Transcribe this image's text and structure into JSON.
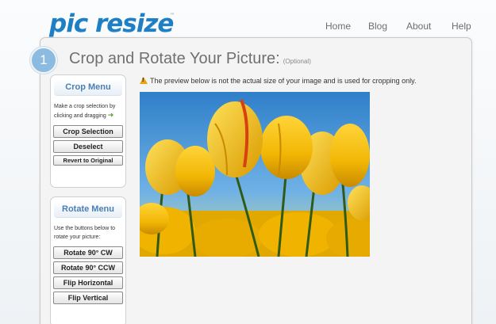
{
  "logo": {
    "text": "pic resize",
    "tm": "™"
  },
  "nav": [
    {
      "label": "Home"
    },
    {
      "label": "Blog"
    },
    {
      "label": "About"
    },
    {
      "label": "Help"
    }
  ],
  "step": {
    "number": "1",
    "title": "Crop and Rotate Your Picture:",
    "optional": "(Optional)"
  },
  "notice": "The preview below is not the actual size of your image and is used for cropping only.",
  "crop_menu": {
    "title": "Crop Menu",
    "instructions": "Make a crop selection by clicking and dragging",
    "buttons": [
      "Crop Selection",
      "Deselect",
      "Revert to Original"
    ]
  },
  "rotate_menu": {
    "title": "Rotate Menu",
    "instructions": "Use the buttons below to rotate your picture:",
    "buttons": [
      "Rotate 90° CW",
      "Rotate 90° CCW",
      "Flip Horizontal",
      "Flip Vertical"
    ]
  },
  "colors": {
    "logo": "#1f7fc4",
    "menu_title": "#4a7fb5",
    "step_circle": "#8cbbe2",
    "sky": "#2f7fc9",
    "tulip": "#f2b705"
  },
  "icons": {
    "warning": "warning-icon",
    "arrow": "green-arrow-icon"
  }
}
